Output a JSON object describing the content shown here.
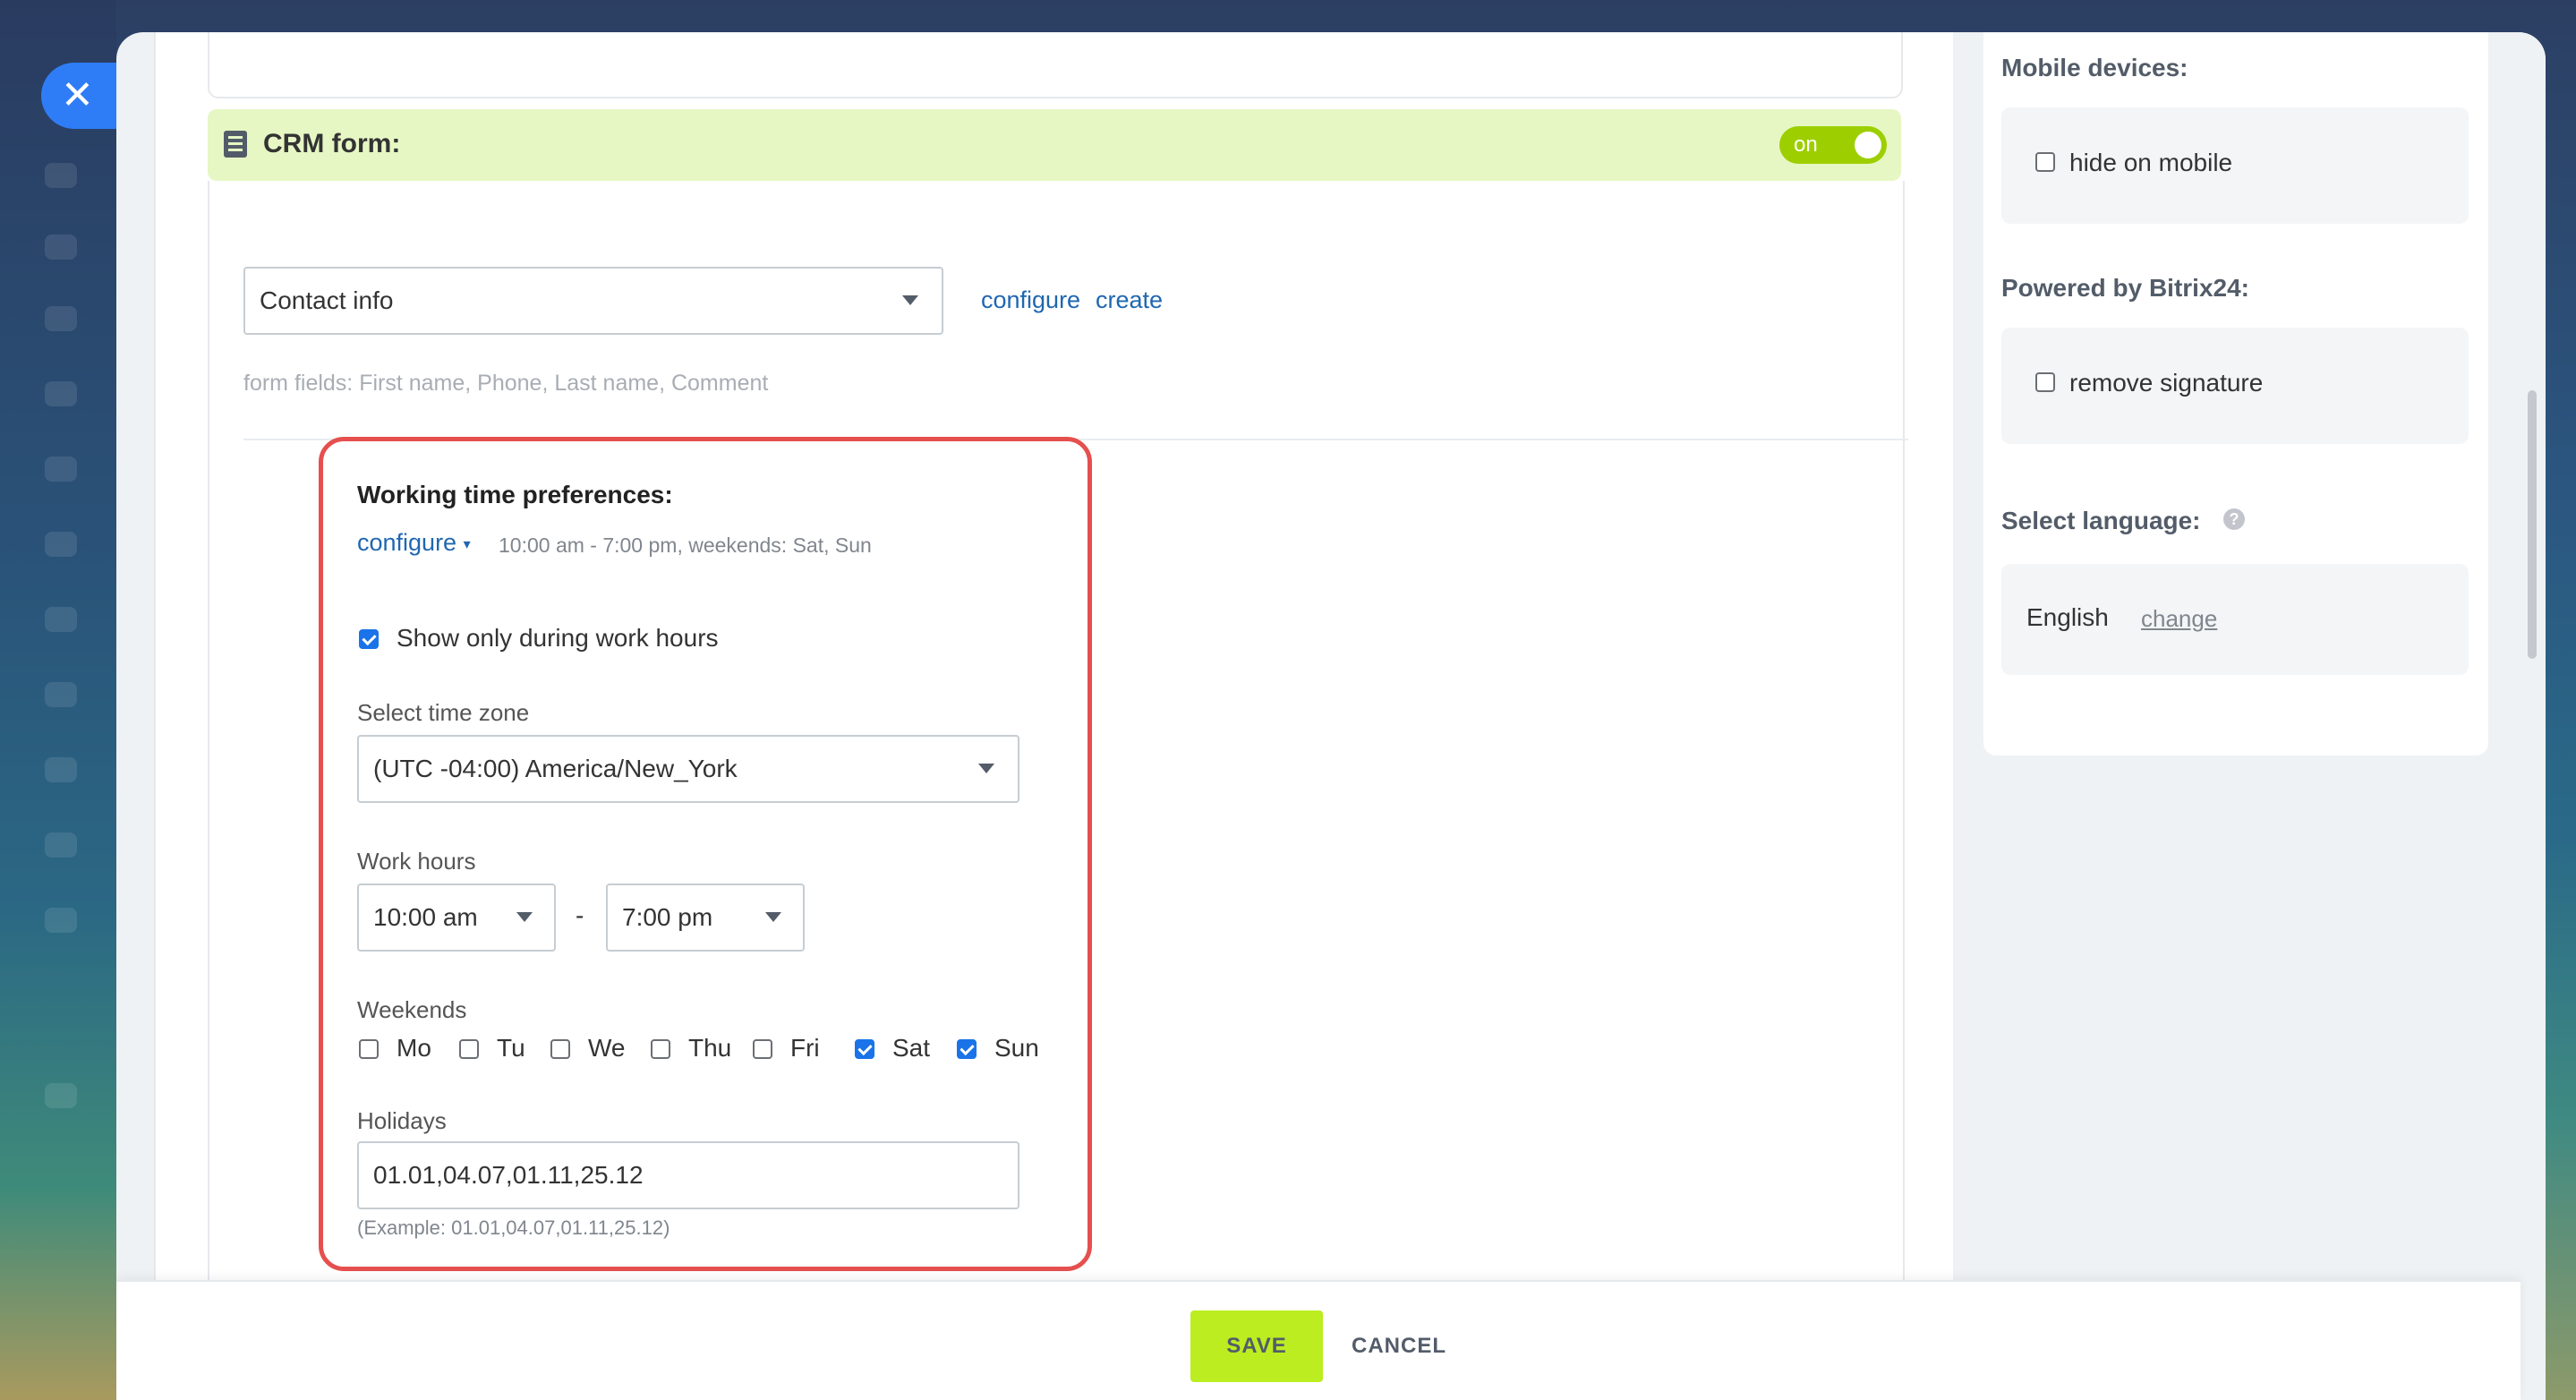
{
  "close_icon": "close-icon",
  "crm": {
    "title": "CRM form:",
    "toggle_label": "on",
    "form_select_value": "Contact info",
    "configure_link": "configure",
    "create_link": "create",
    "form_fields_hint": "form fields: First name, Phone, Last name, Comment"
  },
  "working_time": {
    "title": "Working time preferences:",
    "configure_link": "configure",
    "summary": "10:00 am - 7:00 pm, weekends: Sat, Sun",
    "show_only_label": "Show only during work hours",
    "show_only_checked": true,
    "timezone_label": "Select time zone",
    "timezone_value": "(UTC -04:00) America/New_York",
    "work_hours_label": "Work hours",
    "work_hours_from": "10:00 am",
    "work_hours_separator": "-",
    "work_hours_to": "7:00 pm",
    "weekends_label": "Weekends",
    "days": [
      {
        "label": "Mo",
        "checked": false
      },
      {
        "label": "Tu",
        "checked": false
      },
      {
        "label": "We",
        "checked": false
      },
      {
        "label": "Thu",
        "checked": false
      },
      {
        "label": "Fri",
        "checked": false
      },
      {
        "label": "Sat",
        "checked": true
      },
      {
        "label": "Sun",
        "checked": true
      }
    ],
    "holidays_label": "Holidays",
    "holidays_value": "01.01,04.07,01.11,25.12",
    "holidays_example": "(Example: 01.01,04.07,01.11,25.12)"
  },
  "sidebar": {
    "mobile_title": "Mobile devices:",
    "hide_on_mobile_label": "hide on mobile",
    "hide_on_mobile_checked": false,
    "powered_title": "Powered by Bitrix24:",
    "remove_signature_label": "remove signature",
    "remove_signature_checked": false,
    "language_title": "Select language:",
    "language_help": "?",
    "language_value": "English",
    "change_link": "change"
  },
  "footer": {
    "save_label": "SAVE",
    "cancel_label": "CANCEL"
  },
  "colors": {
    "accent_green": "#bbed21",
    "toggle_green": "#9dcf00",
    "crm_header_bg": "#e6f7c4",
    "highlight_red": "#e5504f",
    "link_blue": "#2067b0",
    "checkbox_blue": "#1a73e8",
    "close_blue": "#2f7df6"
  }
}
